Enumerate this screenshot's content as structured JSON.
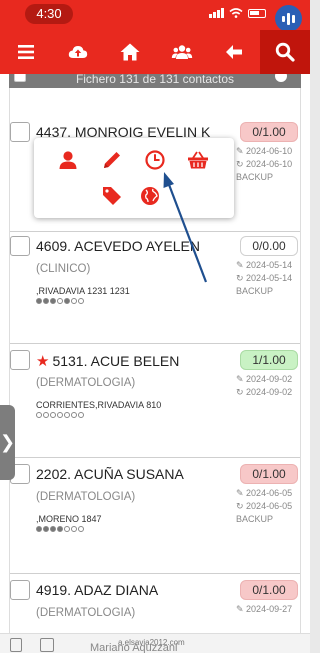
{
  "status": {
    "time": "4:30"
  },
  "toolbar": {
    "items": [
      "menu",
      "upload",
      "home",
      "groups",
      "back",
      "search"
    ]
  },
  "header": {
    "counter_text": "Fichero  131 de 131 contactos"
  },
  "popup": {
    "icons": [
      "person-icon",
      "pencil-icon",
      "clock-icon",
      "basket-icon",
      "tag-icon",
      "globe-icon"
    ]
  },
  "cards": [
    {
      "name": "4437. MONROIG EVELIN K",
      "specialty": "",
      "address": "",
      "badge": "0/1.00",
      "badge_color": "red",
      "date1": "2024-06-10",
      "date2": "2024-06-10",
      "backup": "BACKUP",
      "starred": false,
      "rating_on": 0
    },
    {
      "name": "4609. ACEVEDO AYELEN",
      "specialty": "(CLINICO)",
      "address": ",RIVADAVIA 1231 1231",
      "badge": "0/0.00",
      "badge_color": "white",
      "date1": "2024-05-14",
      "date2": "2024-05-14",
      "backup": "BACKUP",
      "starred": false,
      "rating_on": 2
    },
    {
      "name": "5131. ACUE BELEN",
      "specialty": "(DERMATOLOGIA)",
      "address": "CORRIENTES,RIVADAVIA 810",
      "badge": "1/1.00",
      "badge_color": "green",
      "date1": "2024-09-02",
      "date2": "2024-09-02",
      "backup": "",
      "starred": true,
      "rating_on": 0
    },
    {
      "name": "2202. ACUÑA SUSANA",
      "specialty": "(DERMATOLOGIA)",
      "address": ",MORENO 1847",
      "badge": "0/1.00",
      "badge_color": "red",
      "date1": "2024-06-05",
      "date2": "2024-06-05",
      "backup": "BACKUP",
      "starred": false,
      "rating_on": 4
    },
    {
      "name": "4919. ADAZ DIANA",
      "specialty": "(DERMATOLOGIA)",
      "address": "",
      "badge": "0/1.00",
      "badge_color": "red",
      "date1": "2024-09-27",
      "date2": "",
      "backup": "",
      "starred": false,
      "rating_on": 0
    }
  ],
  "bottom": {
    "domain": "a.elsavia2012.com",
    "user": "Mariano Aquzzani"
  },
  "colors": {
    "brand": "#e8291f",
    "annotation_arrow": "#1f4f8f"
  }
}
